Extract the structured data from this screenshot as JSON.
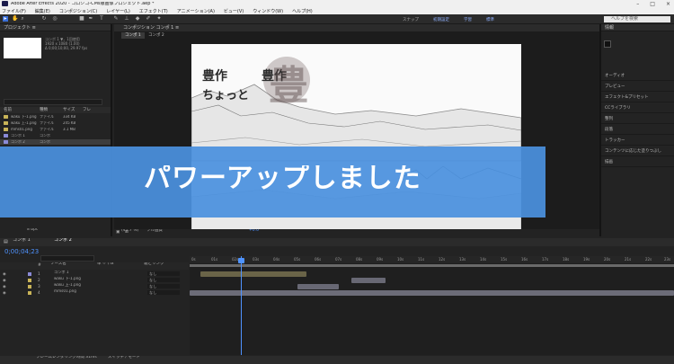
{
  "window": {
    "title": "Adobe After Effects 2020 - コロシゴ-CMs版画像プロジェクト.aep *",
    "controls": [
      "–",
      "□",
      "×"
    ]
  },
  "menu": [
    "ファイル(F)",
    "編集(E)",
    "コンポジション(C)",
    "レイヤー(L)",
    "エフェクト(T)",
    "アニメーション(A)",
    "ビュー(V)",
    "ウィンドウ(W)",
    "ヘルプ(H)"
  ],
  "toolbar": {
    "search_placeholder": "ヘルプを検索",
    "workspace_labels": [
      "スナップ",
      "初期設定",
      "学習",
      "標準"
    ]
  },
  "project_panel": {
    "title": "プロジェクト ≡",
    "info_lines": [
      "コンポ 1 ▼，1回使用",
      "1920 x 1080 (1.00)",
      "Δ 0;00;10;00, 29.97 fps"
    ],
    "columns": [
      "名前",
      "種類",
      "サイズ",
      "フレ"
    ],
    "items": [
      {
        "name": "waku 下-1.png",
        "type": "ファイル",
        "size": "334 KB",
        "color": "#c9b458"
      },
      {
        "name": "waku 上-1.png",
        "type": "ファイル",
        "size": "245 KB",
        "color": "#c9b458"
      },
      {
        "name": "mms01.png",
        "type": "ファイル",
        "size": "3.1 MB",
        "color": "#c9b458"
      },
      {
        "name": "コンポ 1",
        "type": "コンポ",
        "size": "",
        "color": "#8a8ad6"
      },
      {
        "name": "コンポ 2",
        "type": "コンポ",
        "size": "",
        "color": "#8a8ad6"
      }
    ],
    "bpc": "8 bpc"
  },
  "comp_panel": {
    "title": "コンポジション コンポ 1 ≡",
    "tabs": [
      "コンポ 1",
      "コンポ 2"
    ],
    "controls": [
      "(41.7 %)",
      "フル画質",
      "+0.0"
    ]
  },
  "viewer_text": {
    "line1a": "豊作",
    "line1b": "豊作",
    "line2": "ちょっと",
    "seal": "豊"
  },
  "right_panel": {
    "title": "情報",
    "items": [
      "オーディオ",
      "プレビュー",
      "エフェクト&プリセット",
      "CCライブラリ",
      "整列",
      "段落",
      "トラッカー",
      "コンテンツに応じた塗りつぶし",
      "描画"
    ]
  },
  "banner": {
    "text": "パワーアップしました",
    "color": "#4a90de"
  },
  "timeline": {
    "tabs": [
      "コンポ 1",
      "コンポ 2"
    ],
    "current_time": "0;00;04;23",
    "header": [
      "#",
      "ソース名",
      "単 ☆ \\ fx",
      "親とリンク"
    ],
    "layers": [
      {
        "num": "1",
        "name": "コンポ 1",
        "parent": "なし",
        "color": "#8a8ad6"
      },
      {
        "num": "2",
        "name": "waku 下-1.png",
        "parent": "なし",
        "color": "#c9b458"
      },
      {
        "num": "3",
        "name": "waku 上-1.png",
        "parent": "なし",
        "color": "#c9b458"
      },
      {
        "num": "4",
        "name": "mms01.png",
        "parent": "なし",
        "color": "#c9b458"
      }
    ],
    "ruler": [
      "0s",
      "01s",
      "02s",
      "03s",
      "04s",
      "05s",
      "06s",
      "07s",
      "08s",
      "09s",
      "10s",
      "11s",
      "12s",
      "13s",
      "14s",
      "15s",
      "16s",
      "17s",
      "18s",
      "19s",
      "20s",
      "21s",
      "22s",
      "23s"
    ]
  },
  "status": {
    "left": "フレームレンダリング時間 31ms",
    "right": "スイッチ / モード"
  }
}
